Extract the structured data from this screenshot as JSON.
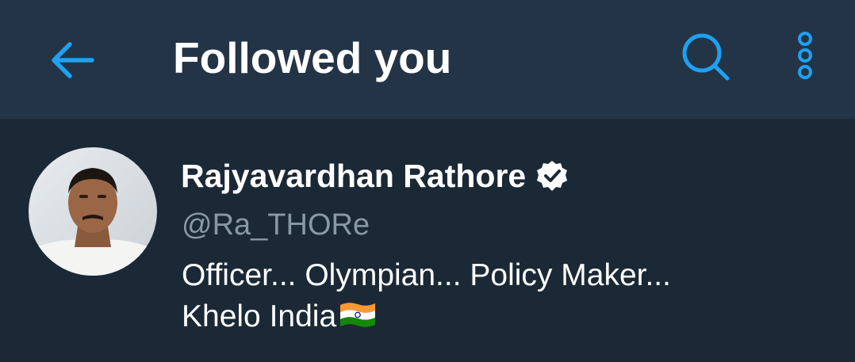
{
  "header": {
    "title": "Followed you",
    "back_icon": "arrow-left-icon",
    "search_icon": "search-icon",
    "more_icon": "more-vertical-icon"
  },
  "colors": {
    "accent": "#1da1f2",
    "header_bg": "#243447",
    "body_bg": "#1b2836",
    "secondary_text": "#8899a6"
  },
  "user": {
    "name": "Rajyavardhan Rathore",
    "verified_icon": "verified-badge-icon",
    "handle": "@Ra_THORe",
    "bio_line1": "Officer... Olympian... Policy Maker...",
    "bio_line2": "Khelo India",
    "bio_flag_icon": "india-flag-icon"
  }
}
